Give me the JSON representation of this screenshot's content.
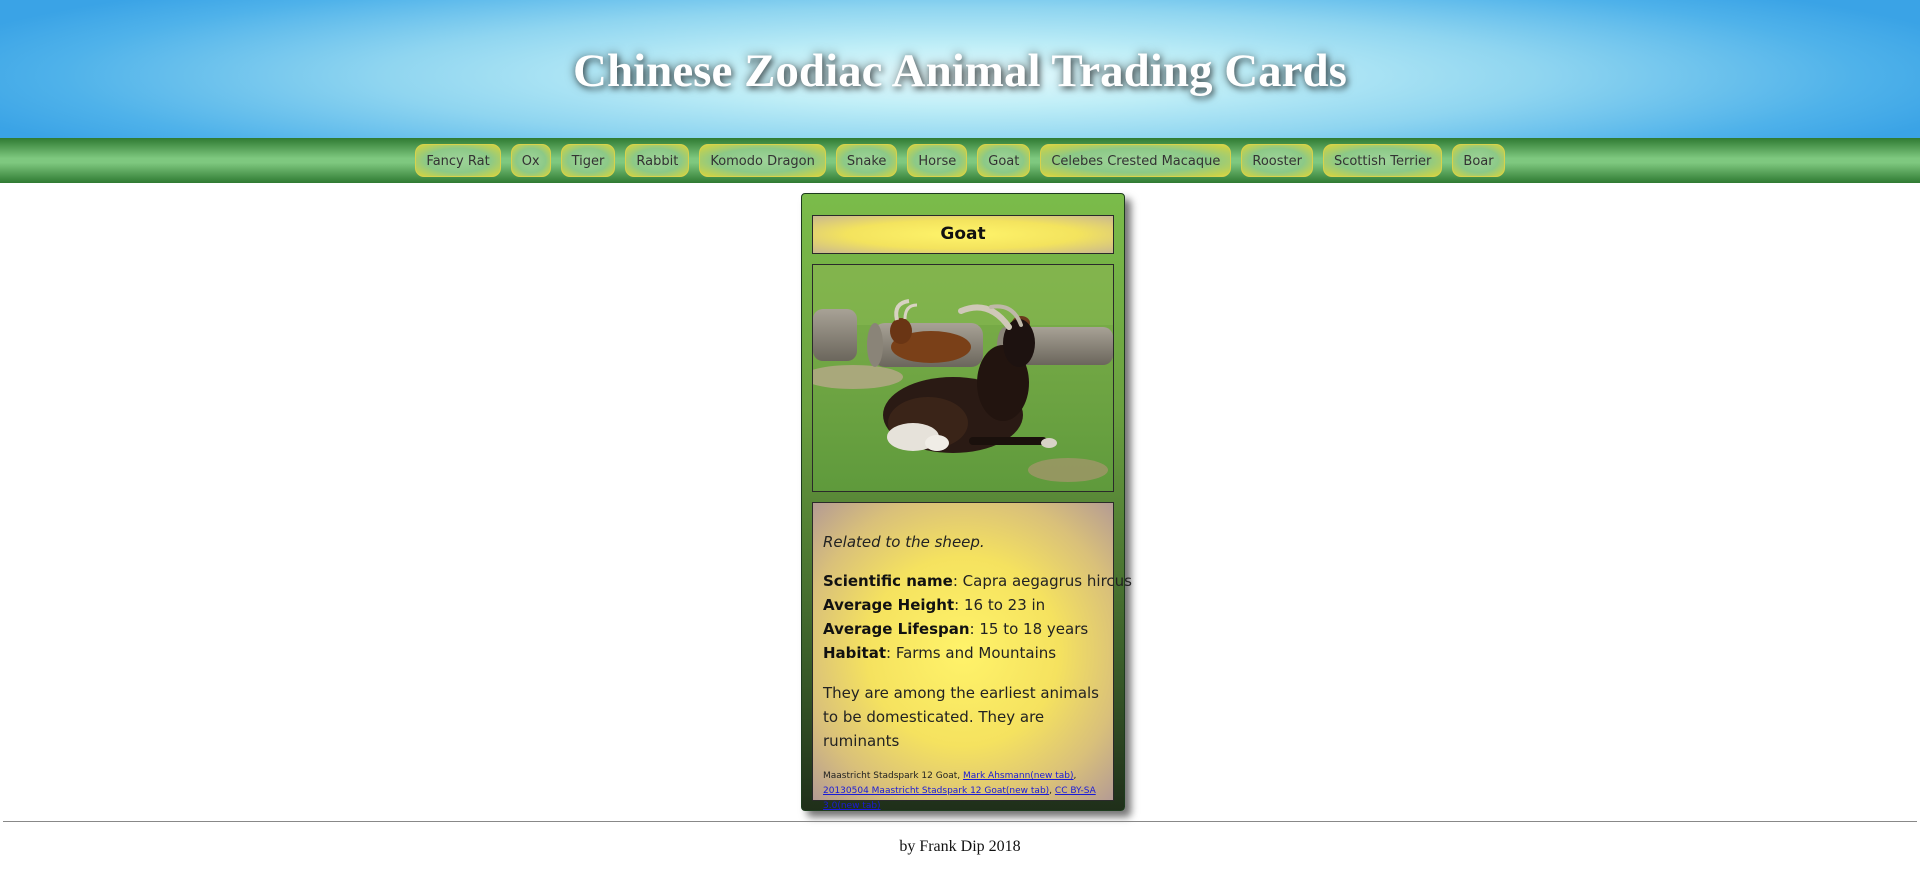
{
  "site": {
    "title": "Chinese Zodiac Animal Trading Cards"
  },
  "nav": {
    "items": [
      {
        "label": "Fancy Rat"
      },
      {
        "label": "Ox"
      },
      {
        "label": "Tiger"
      },
      {
        "label": "Rabbit"
      },
      {
        "label": "Komodo Dragon"
      },
      {
        "label": "Snake"
      },
      {
        "label": "Horse"
      },
      {
        "label": "Goat"
      },
      {
        "label": "Celebes Crested Macaque"
      },
      {
        "label": "Rooster"
      },
      {
        "label": "Scottish Terrier"
      },
      {
        "label": "Boar"
      }
    ]
  },
  "card": {
    "title": "Goat",
    "tagline": "Related to the sheep.",
    "facts": [
      {
        "label": "Scientific name",
        "value": ": Capra aegagrus hircus"
      },
      {
        "label": "Average Height",
        "value": ": 16 to 23 in"
      },
      {
        "label": "Average Lifespan",
        "value": ": 15 to 18 years"
      },
      {
        "label": "Habitat",
        "value": ": Farms and Mountains"
      }
    ],
    "description": "They are among the earliest animals to be domesticated. They are ruminants",
    "credit": {
      "prefix": "Maastricht Stadspark 12 Goat, ",
      "author_link": "Mark Ahsmann(new tab)",
      "sep1": ", ",
      "source_link": "20130504 Maastricht Stadspark 12 Goat(new tab)",
      "sep2": ", ",
      "license_link": "CC BY-SA 3.0(new tab)"
    }
  },
  "footer": {
    "text": "by Frank Dip 2018"
  },
  "colors": {
    "header_sky": "#4fb2ea",
    "nav_green": "#2f7a32",
    "card_green": "#6aa03f",
    "panel_yellow": "#fff36a",
    "link": "#1a1ad6"
  }
}
